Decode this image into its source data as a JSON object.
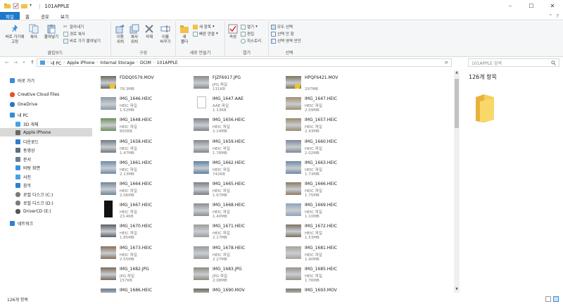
{
  "window": {
    "title": "101APPLE",
    "controls": [
      "–",
      "☐",
      "✕"
    ]
  },
  "tabs": [
    {
      "label": "파일",
      "active": true
    },
    {
      "label": "홈"
    },
    {
      "label": "공유"
    },
    {
      "label": "보기"
    }
  ],
  "ribbon": {
    "clipboard": {
      "label": "클립보드",
      "pin": "바로 가기에\n고정",
      "copy": "복사",
      "paste": "붙여넣기",
      "cut": "잘라내기",
      "copy_path": "경로 복사",
      "paste_shortcut": "바로 가기 붙여넣기"
    },
    "organize": {
      "label": "구성",
      "move_to": "이동\n위치",
      "copy_to": "복사\n위치",
      "delete": "삭제",
      "rename": "이름\n바꾸기"
    },
    "new": {
      "label": "새로 만들기",
      "new_folder": "새\n폴더",
      "new_item": "새 항목",
      "easy_access": "빠른 연결"
    },
    "open": {
      "label": "열기",
      "properties": "속성",
      "open": "열기",
      "edit": "편집",
      "history": "히스토리"
    },
    "select": {
      "label": "선택",
      "select_all": "모두 선택",
      "select_none": "선택 안 함",
      "invert": "선택 영역 반전"
    }
  },
  "address": {
    "crumbs": [
      "내 PC",
      "Apple iPhone",
      "Internal Storage",
      "DCIM",
      "101APPLE"
    ],
    "search_placeholder": "101APPLE 검색"
  },
  "nav": [
    {
      "label": "바로 가기",
      "icon": "star-icon",
      "color": "#3b8ad9"
    },
    {
      "label": "Creative Cloud Files",
      "icon": "cloud-icon",
      "color": "#e8512f"
    },
    {
      "label": "OneDrive",
      "icon": "onedrive-icon",
      "color": "#2a73c5"
    },
    {
      "label": "내 PC",
      "icon": "pc-icon",
      "color": "#2e8fd6"
    },
    {
      "label": "3D 개체",
      "icon": "cube-icon",
      "color": "#4aa1e0"
    },
    {
      "label": "Apple iPhone",
      "icon": "phone-icon",
      "color": "#666666",
      "selected": true
    },
    {
      "label": "다운로드",
      "icon": "download-icon",
      "color": "#2d7fd0"
    },
    {
      "label": "동영상",
      "icon": "video-icon",
      "color": "#5a6f8a"
    },
    {
      "label": "문서",
      "icon": "document-icon",
      "color": "#6f7c8a"
    },
    {
      "label": "바탕 화면",
      "icon": "desktop-icon",
      "color": "#3a94dd"
    },
    {
      "label": "사진",
      "icon": "pictures-icon",
      "color": "#4aa1e0"
    },
    {
      "label": "음악",
      "icon": "music-icon",
      "color": "#2d7fd0"
    },
    {
      "label": "로컬 디스크 (C:)",
      "icon": "disk-icon",
      "color": "#7a7a7a"
    },
    {
      "label": "로컬 디스크 (D:)",
      "icon": "disk-icon",
      "color": "#7a7a7a"
    },
    {
      "label": "DriverCD (E:)",
      "icon": "cd-icon",
      "color": "#555555"
    },
    {
      "label": "네트워크",
      "icon": "network-icon",
      "color": "#2d7fd0"
    }
  ],
  "files": [
    {
      "name": "FDDQ0579.MOV",
      "type": "",
      "size": "78.3MB",
      "thumb": "#6b6b5a",
      "badge": true
    },
    {
      "name": "FJZF6917.JPG",
      "type": "JPG 파일",
      "size": "131KB",
      "thumb": "#8a8a8a"
    },
    {
      "name": "HPQF6421.MOV",
      "type": "",
      "size": "297MB",
      "thumb": "#7d7358",
      "badge": true
    },
    {
      "name": "IMG_1646.HEIC",
      "type": "HEIC 파일",
      "size": "1.52MB",
      "thumb": "#8b9aa5"
    },
    {
      "name": "IMG_1647.AAE",
      "type": "AAE 파일",
      "size": "1.13KB",
      "thumb": "doc"
    },
    {
      "name": "IMG_1647.HEIC",
      "type": "HEIC 파일",
      "size": "2.09MB",
      "thumb": "#a08e6f"
    },
    {
      "name": "IMG_1648.HEIC",
      "type": "HEIC 파일",
      "size": "893KB",
      "thumb": "#6c8f59"
    },
    {
      "name": "IMG_1656.HEIC",
      "type": "HEIC 파일",
      "size": "2.14MB",
      "thumb": "#7f8388"
    },
    {
      "name": "IMG_1657.HEIC",
      "type": "HEIC 파일",
      "size": "2.43MB",
      "thumb": "#9a8a6b"
    },
    {
      "name": "IMG_1658.HEIC",
      "type": "HEIC 파일",
      "size": "1.47MB",
      "thumb": "#707880"
    },
    {
      "name": "IMG_1659.HEIC",
      "type": "HEIC 파일",
      "size": "1.78MB",
      "thumb": "#858585"
    },
    {
      "name": "IMG_1660.HEIC",
      "type": "HEIC 파일",
      "size": "2.02MB",
      "thumb": "#7e8895"
    },
    {
      "name": "IMG_1661.HEIC",
      "type": "HEIC 파일",
      "size": "2.13MB",
      "thumb": "#6f8aa8"
    },
    {
      "name": "IMG_1662.HEIC",
      "type": "HEIC 파일",
      "size": "742KB",
      "thumb": "#5f7f9e"
    },
    {
      "name": "IMG_1663.HEIC",
      "type": "HEIC 파일",
      "size": "1.73MB",
      "thumb": "#6f88a5"
    },
    {
      "name": "IMG_1664.HEIC",
      "type": "HEIC 파일",
      "size": "2.06MB",
      "thumb": "#6f8696"
    },
    {
      "name": "IMG_1665.HEIC",
      "type": "HEIC 파일",
      "size": "1.67MB",
      "thumb": "#7a7f86"
    },
    {
      "name": "IMG_1666.HEIC",
      "type": "HEIC 파일",
      "size": "1.75MB",
      "thumb": "#8c7a62"
    },
    {
      "name": "IMG_1667.HEIC",
      "type": "HEIC 파일",
      "size": "23.4KB",
      "thumb": "vert"
    },
    {
      "name": "IMG_1668.HEIC",
      "type": "HEIC 파일",
      "size": "1.40MB",
      "thumb": "#8e8e8e"
    },
    {
      "name": "IMG_1669.HEIC",
      "type": "HEIC 파일",
      "size": "1.10MB",
      "thumb": "#8fa3b8"
    },
    {
      "name": "IMG_1670.HEIC",
      "type": "HEIC 파일",
      "size": "1.85MB",
      "thumb": "#5a5f66"
    },
    {
      "name": "IMG_1671.HEIC",
      "type": "HEIC 파일",
      "size": "2.17MB",
      "thumb": "#9c9c9c"
    },
    {
      "name": "IMG_1672.HEIC",
      "type": "HEIC 파일",
      "size": "1.53MB",
      "thumb": "#7e6f62"
    },
    {
      "name": "IMG_1673.HEIC",
      "type": "HEIC 파일",
      "size": "2.55MB",
      "thumb": "#8a6f5c"
    },
    {
      "name": "IMG_1678.HEIC",
      "type": "HEIC 파일",
      "size": "2.27MB",
      "thumb": "#9a9a9a"
    },
    {
      "name": "IMG_1681.HEIC",
      "type": "HEIC 파일",
      "size": "1.40MB",
      "thumb": "#a7a39c"
    },
    {
      "name": "IMG_1682.JPG",
      "type": "JPG 파일",
      "size": "157KB",
      "thumb": "#7c6a58"
    },
    {
      "name": "IMG_1683.JPG",
      "type": "JPG 파일",
      "size": "2.08MB",
      "thumb": "#8c8c7a"
    },
    {
      "name": "IMG_1685.HEIC",
      "type": "HEIC 파일",
      "size": "1.76MB",
      "thumb": "#98928a"
    },
    {
      "name": "IMG_1686.HEIC",
      "type": "",
      "size": "",
      "thumb": "#6c7a8a"
    },
    {
      "name": "IMG_1690.MOV",
      "type": "",
      "size": "",
      "thumb": "#6a6a60"
    },
    {
      "name": "IMG_1693.MOV",
      "type": "",
      "size": "",
      "thumb": "#7a7a70"
    }
  ],
  "details": {
    "count": "126개 항목"
  },
  "status": {
    "count": "126개 항목"
  }
}
